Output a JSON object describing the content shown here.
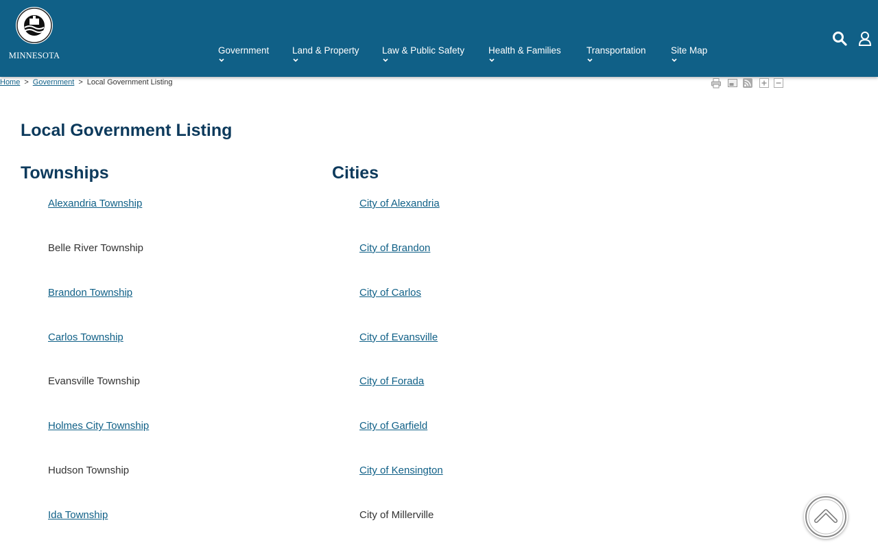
{
  "header": {
    "logo": {
      "seal_text": "DOUGLAS COUNTY",
      "state_text": "MINNESOTA"
    },
    "nav": [
      {
        "label": "Government"
      },
      {
        "label": "Land & Property"
      },
      {
        "label": "Law & Public Safety"
      },
      {
        "label": "Health & Families"
      },
      {
        "label": "Transportation"
      },
      {
        "label": "Site Map"
      }
    ],
    "icons": [
      "search-icon",
      "user-icon"
    ],
    "colors": {
      "bar": "#106087"
    }
  },
  "breadcrumb": {
    "items": [
      {
        "label": "Home",
        "link": true
      },
      {
        "label": "Government",
        "link": true
      },
      {
        "label": "Local Government Listing",
        "link": false
      }
    ],
    "separator": ">"
  },
  "tools": [
    "print-icon",
    "email-icon",
    "rss-icon",
    "zoom-in-icon",
    "zoom-out-icon"
  ],
  "main": {
    "title": "Local Government Listing",
    "townships": {
      "heading": "Townships",
      "items": [
        {
          "label": "Alexandria Township",
          "link": true
        },
        {
          "label": "Belle River Township",
          "link": false
        },
        {
          "label": "Brandon Township",
          "link": true
        },
        {
          "label": "Carlos Township",
          "link": true
        },
        {
          "label": "Evansville Township",
          "link": false
        },
        {
          "label": "Holmes City Township",
          "link": true
        },
        {
          "label": "Hudson Township",
          "link": false
        },
        {
          "label": "Ida Township",
          "link": true
        }
      ]
    },
    "cities": {
      "heading": "Cities",
      "items": [
        {
          "label": "City of Alexandria",
          "link": true
        },
        {
          "label": "City of Brandon",
          "link": true
        },
        {
          "label": "City of Carlos",
          "link": true
        },
        {
          "label": "City of Evansville",
          "link": true
        },
        {
          "label": "City of Forada",
          "link": true
        },
        {
          "label": "City of Garfield",
          "link": true
        },
        {
          "label": "City of Kensington",
          "link": true
        },
        {
          "label": "City of Millerville",
          "link": false
        }
      ]
    }
  },
  "scroll_top": {
    "icon": "chevron-up-icon"
  }
}
